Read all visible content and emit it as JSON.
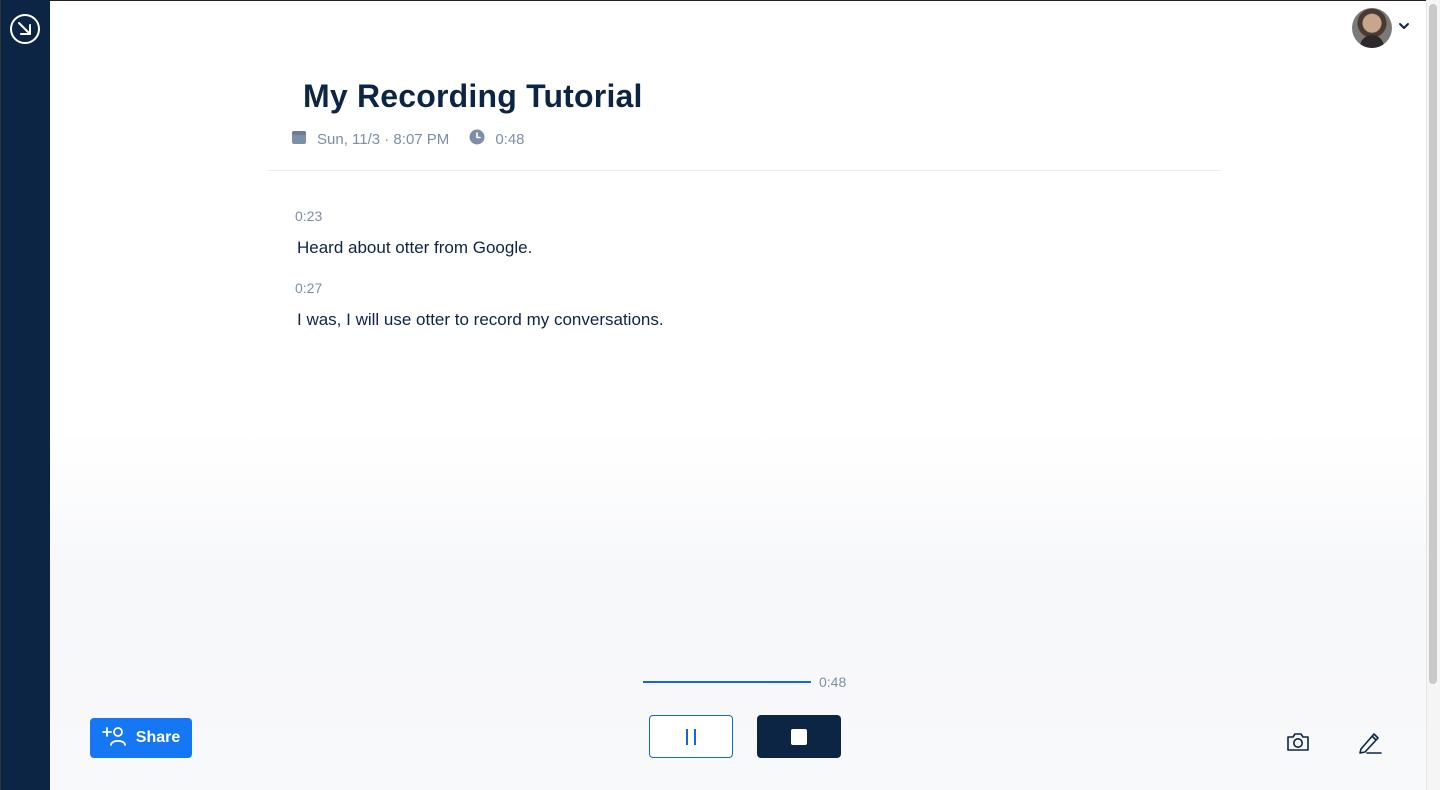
{
  "header": {
    "title": "My Recording Tutorial",
    "date": "Sun, 11/3 · 8:07 PM",
    "duration": "0:48",
    "date_icon": "calendar-icon",
    "duration_icon": "clock-icon"
  },
  "transcript": [
    {
      "time": "0:23",
      "text": "Heard about otter from Google."
    },
    {
      "time": "0:27",
      "text": "I was, I will use otter to record my conversations."
    }
  ],
  "player": {
    "elapsed": "0:48",
    "progress_fraction": 1.0
  },
  "controls": {
    "share_label": "Share",
    "pause_icon": "pause-icon",
    "stop_icon": "stop-icon",
    "camera_icon": "camera-icon",
    "annotate_icon": "pen-icon"
  },
  "colors": {
    "navy": "#0d2545",
    "accent": "#1677f5",
    "muted": "#7d8fa6"
  }
}
